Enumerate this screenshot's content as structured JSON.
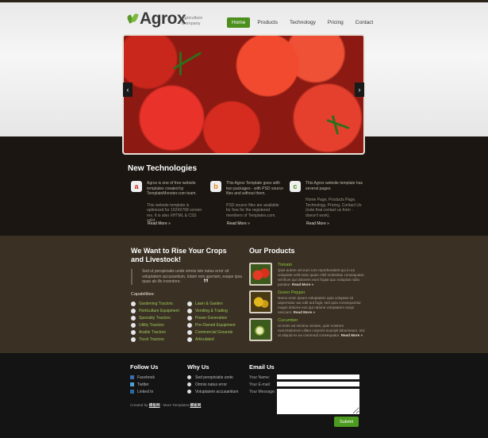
{
  "header": {
    "logo_name": "Agrox",
    "logo_tagline": "Agriculture Company",
    "nav": [
      {
        "label": "Home",
        "active": true
      },
      {
        "label": "Products",
        "active": false
      },
      {
        "label": "Technology",
        "active": false
      },
      {
        "label": "Pricing",
        "active": false
      },
      {
        "label": "Contact",
        "active": false
      }
    ]
  },
  "banner": {
    "prev_label": "‹",
    "next_label": "›"
  },
  "technologies": {
    "title": "New Technologies",
    "items": [
      {
        "icon": "a",
        "icon_color": "#c62c1e",
        "text": "Agrox is one of free website templates created by TemplateMonster.com team.",
        "text2": "This website template is optimized for 1024X768 screen res. It is also XHTML & CSS valid.",
        "link": "Read More »"
      },
      {
        "icon": "b",
        "icon_color": "#e18b1c",
        "text": "This Agrox Template goes with two packages - with PSD source files and without them.",
        "text2": "PSD source files are available for free for the registered members of Templates.com.",
        "link": "Read More »"
      },
      {
        "icon": "c",
        "icon_color": "#4c8f1c",
        "text": "This Agrox website template has several pages:",
        "text2": "Home Page, Products Page, Technology, Pricing, Contact Us (note that contact us form - doesn't work).",
        "link": "Read More »"
      }
    ]
  },
  "crops": {
    "title_line1": "We Want to Rise Your Crops",
    "title_line2": "and Livestock!",
    "quote": "Sed ut perspiciatis unde omnis iste natus error sit voluptatem accusantium, totam rem aperiam, eaque ipsa quae ab illo inventore.",
    "capabilities_label": "Capabilities:",
    "capabilities_left": [
      "Gardening Tractors",
      "Horticulture Equipment",
      "Specialty Tractors",
      "Utility Tractors",
      "Arable Tractors",
      "Truck Tractors"
    ],
    "capabilities_right": [
      "Lawn & Garden",
      "Vending & Trading",
      "Power Generation",
      "Pre-Owned Equipment",
      "Commercial Grounds",
      "Articulated"
    ]
  },
  "products": {
    "title": "Our Products",
    "items": [
      {
        "name": "Tomato",
        "desc": "Quis autem vel eum iure reprehenderit qui in ea voluptate velit esse quam nihil molestiae consequatur, vel illum qui dolorem eum fugiat quo voluptas nulla pariatur.",
        "link": "Read More »"
      },
      {
        "name": "Green Pepper",
        "desc": "Nemo enim ipsam voluptatem quia voluptas sit aspernatur aut odit aut fugit, sed quia consequuntur magni dolores eos qui ratione voluptatem sequi nesciunt.",
        "link": "Read More »"
      },
      {
        "name": "Cucumber",
        "desc": "Ut enim ad minima veniam, quis nostrum exercitationem ullam corporis suscipit laboriosam, nisi ut aliquid ex ea commodi consequatur.",
        "link": "Read More »"
      }
    ]
  },
  "footer": {
    "follow_title": "Follow Us",
    "follow_items": [
      "Facebook",
      "Twitter",
      "Linked In"
    ],
    "why_title": "Why Us",
    "why_items": [
      "Sed perspiciatis unde",
      "Omnis natus error",
      "Voluptatem accusantium"
    ],
    "email_title": "Email Us",
    "form_labels": [
      "Your Name:",
      "Your E-mail:",
      "Your Message:"
    ],
    "submit_label": "Submit",
    "copyright_prefix": "Created by",
    "copyright_link1": "模板网",
    "copyright_mid": "- More Templates",
    "copyright_link2": "模板网"
  }
}
